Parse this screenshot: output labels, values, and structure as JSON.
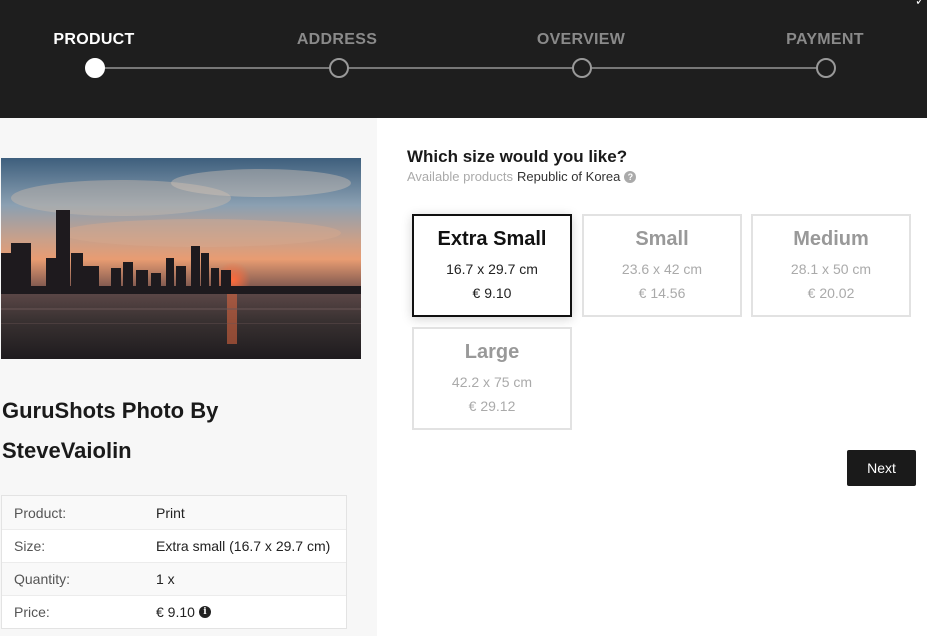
{
  "stepper": {
    "steps": [
      {
        "label": "PRODUCT",
        "active": true
      },
      {
        "label": "ADDRESS",
        "active": false
      },
      {
        "label": "OVERVIEW",
        "active": false
      },
      {
        "label": "PAYMENT",
        "active": false
      }
    ]
  },
  "product": {
    "title_line1": "GuruShots Photo By",
    "title_line2": "SteveVaiolin",
    "image_icon": "city-skyline-sunset-photo",
    "details": [
      {
        "key": "Product:",
        "value": "Print"
      },
      {
        "key": "Size:",
        "value": "Extra small (16.7 x 29.7 cm)"
      },
      {
        "key": "Quantity:",
        "value": "1 x"
      },
      {
        "key": "Price:",
        "value": "€ 9.10"
      }
    ]
  },
  "size_selection": {
    "question": "Which size would you like?",
    "available_label": "Available products",
    "country": "Republic of Korea",
    "options": [
      {
        "name": "Extra Small",
        "dimensions": "16.7 x 29.7 cm",
        "price": "€ 9.10",
        "selected": true
      },
      {
        "name": "Small",
        "dimensions": "23.6 x 42 cm",
        "price": "€ 14.56",
        "selected": false
      },
      {
        "name": "Medium",
        "dimensions": "28.1 x 50 cm",
        "price": "€ 20.02",
        "selected": false
      },
      {
        "name": "Large",
        "dimensions": "42.2 x 75 cm",
        "price": "€ 29.12",
        "selected": false
      }
    ]
  },
  "actions": {
    "next_label": "Next"
  },
  "colors": {
    "header_bg": "#1e1e1e",
    "accent": "#1a1a1a",
    "inactive": "#999999"
  }
}
